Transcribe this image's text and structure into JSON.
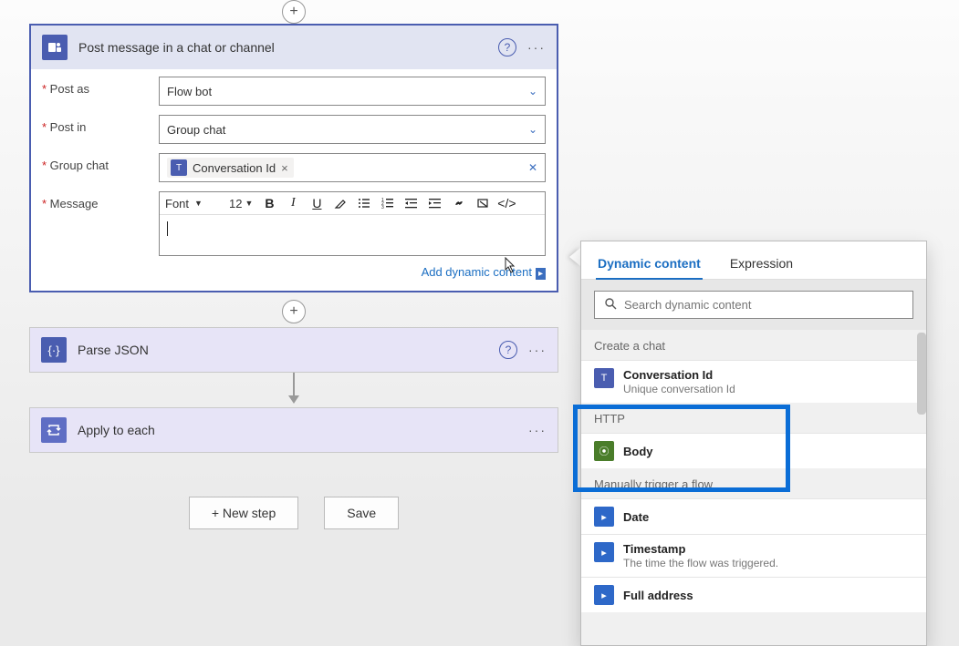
{
  "card1": {
    "title": "Post message in a chat or channel",
    "fields": {
      "post_as": {
        "label": "Post as",
        "value": "Flow bot"
      },
      "post_in": {
        "label": "Post in",
        "value": "Group chat"
      },
      "group_chat": {
        "label": "Group chat",
        "token": "Conversation Id"
      },
      "message": {
        "label": "Message"
      }
    },
    "toolbar": {
      "font": "Font",
      "size": "12"
    },
    "add_dc": "Add dynamic content"
  },
  "card2": {
    "title": "Parse JSON"
  },
  "card3": {
    "title": "Apply to each"
  },
  "buttons": {
    "new_step": "+ New step",
    "save": "Save"
  },
  "dc_panel": {
    "tabs": {
      "dynamic": "Dynamic content",
      "expression": "Expression"
    },
    "search_placeholder": "Search dynamic content",
    "groups": [
      {
        "name": "Create a chat",
        "items": [
          {
            "icon": "teams",
            "label": "Conversation Id",
            "desc": "Unique conversation Id"
          }
        ]
      },
      {
        "name": "HTTP",
        "items": [
          {
            "icon": "green",
            "label": "Body"
          }
        ]
      },
      {
        "name": "Manually trigger a flow",
        "items": [
          {
            "icon": "flow",
            "label": "Date"
          },
          {
            "icon": "flow",
            "label": "Timestamp",
            "desc": "The time the flow was triggered."
          },
          {
            "icon": "flow",
            "label": "Full address"
          }
        ]
      }
    ]
  }
}
